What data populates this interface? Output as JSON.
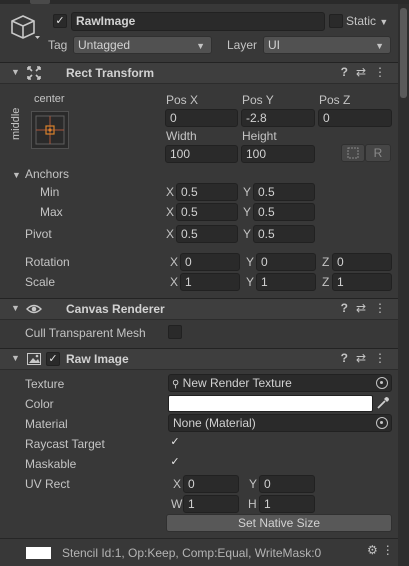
{
  "object": {
    "name": "RawImage",
    "static_label": "Static",
    "tag_label": "Tag",
    "tag_value": "Untagged",
    "layer_label": "Layer",
    "layer_value": "UI"
  },
  "rect_transform": {
    "title": "Rect Transform",
    "anchor_preset_h": "center",
    "anchor_preset_v": "middle",
    "pos_x_label": "Pos X",
    "pos_y_label": "Pos Y",
    "pos_z_label": "Pos Z",
    "pos_x": "0",
    "pos_y": "-2.8",
    "pos_z": "0",
    "width_label": "Width",
    "height_label": "Height",
    "width": "100",
    "height": "100",
    "raw_label": "R",
    "anchors_label": "Anchors",
    "min_label": "Min",
    "max_label": "Max",
    "min_x": "0.5",
    "min_y": "0.5",
    "max_x": "0.5",
    "max_y": "0.5",
    "pivot_label": "Pivot",
    "pivot_x": "0.5",
    "pivot_y": "0.5",
    "rotation_label": "Rotation",
    "rot_x": "0",
    "rot_y": "0",
    "rot_z": "0",
    "scale_label": "Scale",
    "scale_x": "1",
    "scale_y": "1",
    "scale_z": "1"
  },
  "axes": {
    "x": "X",
    "y": "Y",
    "z": "Z",
    "w": "W",
    "h": "H"
  },
  "canvas_renderer": {
    "title": "Canvas Renderer",
    "cull_label": "Cull Transparent Mesh"
  },
  "raw_image": {
    "title": "Raw Image",
    "texture_label": "Texture",
    "texture_value": "New Render Texture",
    "color_label": "Color",
    "color_value": "#ffffff",
    "material_label": "Material",
    "material_value": "None (Material)",
    "raycast_label": "Raycast Target",
    "maskable_label": "Maskable",
    "uvrect_label": "UV Rect",
    "uv_x": "0",
    "uv_y": "0",
    "uv_w": "1",
    "uv_h": "1",
    "native_size_label": "Set Native Size"
  },
  "footer": {
    "stencil_text": "Stencil Id:1, Op:Keep, Comp:Equal, WriteMask:0"
  },
  "icons": {
    "help": "?",
    "settings": "⇄",
    "menu": "⋮",
    "check": "✓",
    "eyedropper": "⁄"
  },
  "colors": {
    "panel": "#383838",
    "header": "#3e3e3e",
    "field": "#2a2a2a",
    "anchor_accent": "#d9822b"
  }
}
